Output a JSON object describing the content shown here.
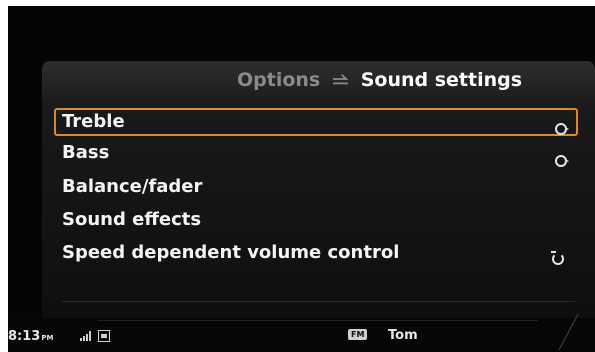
{
  "header": {
    "parent_label": "Options",
    "back_glyph": "⥬",
    "title": "Sound settings"
  },
  "menu": {
    "items": [
      {
        "label": "Treble",
        "selected": true,
        "icon": "knob-icon"
      },
      {
        "label": "Bass",
        "selected": false,
        "icon": "knob-icon"
      },
      {
        "label": "Balance/fader",
        "selected": false,
        "icon": ""
      },
      {
        "label": "Sound effects",
        "selected": false,
        "icon": ""
      },
      {
        "label": "Speed dependent volume control",
        "selected": false,
        "icon": "rotate-icon"
      }
    ]
  },
  "status": {
    "time": "8:13",
    "ampm": "PM",
    "source_badge": "FM",
    "station": "Tom"
  },
  "colors": {
    "accent_selection": "#e08a1a",
    "background": "#050505",
    "text": "#f4f4f4"
  }
}
